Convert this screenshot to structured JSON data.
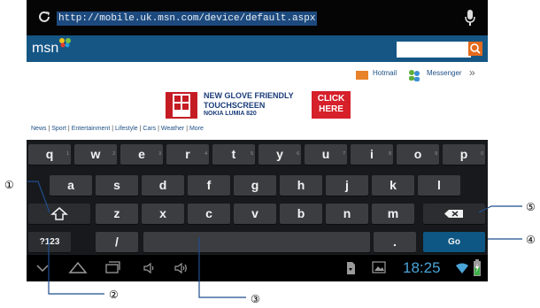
{
  "browser": {
    "url": "http://mobile.uk.msn.com/device/default.aspx"
  },
  "msn": {
    "logo_text": "msn",
    "hotmail_label": "Hotmail",
    "messenger_label": "Messenger",
    "more_chevron": "»"
  },
  "ad": {
    "line1": "NEW GLOVE FRIENDLY",
    "line2": "TOUCHSCREEN",
    "line3": "NOKIA LUMIA 820",
    "cta_line1": "CLICK",
    "cta_line2": "HERE"
  },
  "nav_links": [
    "News",
    "Sport",
    "Entertainment",
    "Lifestyle",
    "Cars",
    "Weather",
    "More"
  ],
  "keyboard": {
    "row1": [
      "q",
      "w",
      "e",
      "r",
      "t",
      "y",
      "u",
      "i",
      "o",
      "p"
    ],
    "row1_hints": [
      "1",
      "2",
      "3",
      "4",
      "5",
      "6",
      "7",
      "8",
      "9",
      "0"
    ],
    "row2": [
      "a",
      "s",
      "d",
      "f",
      "g",
      "h",
      "j",
      "k",
      "l"
    ],
    "row3": [
      "z",
      "x",
      "c",
      "v",
      "b",
      "n",
      "m"
    ],
    "symbols_label": "?123",
    "slash_label": "/",
    "period_label": ".",
    "go_label": "Go"
  },
  "status": {
    "time": "18:25"
  },
  "callouts": {
    "c1": "①",
    "c2": "②",
    "c3": "③",
    "c4": "④",
    "c5": "⑤"
  },
  "colors": {
    "url_highlight": "#1d4a7e",
    "msn_blue": "#155685",
    "go_key": "#0e5784",
    "clock": "#4aa5d8",
    "ad_red": "#d6202a"
  }
}
